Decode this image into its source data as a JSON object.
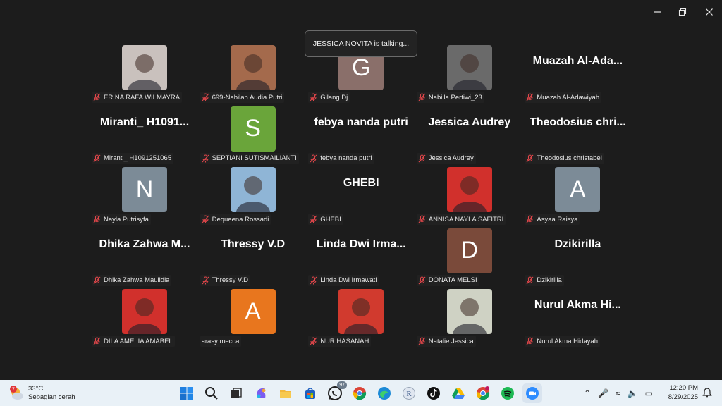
{
  "window": {
    "controls": {
      "minimize": "minimize-icon",
      "maximize": "restore-icon",
      "close": "close-icon"
    }
  },
  "banner": {
    "text": "JESSICA NOVITA is talking..."
  },
  "participants": [
    {
      "name": "ERINA RAFA WILMAYRA",
      "type": "photo",
      "color": "#c9c1bd"
    },
    {
      "name": "699-Nabilah Audia Putri",
      "type": "photo",
      "color": "#a46a4c"
    },
    {
      "name": "Gilang Dj",
      "type": "letter",
      "letter": "G",
      "color": "#8a6f6a"
    },
    {
      "name": "Nabilla Pertiwi_23",
      "type": "photo",
      "color": "#6a6a6a"
    },
    {
      "name": "Muazah Al-Adawiyah",
      "type": "text",
      "display": "Muazah  Al-Ada..."
    },
    {
      "name": "Miranti_ H1091251065",
      "type": "text",
      "display": "Miranti_  H1091..."
    },
    {
      "name": "SEPTIANI SUTISMAILIANTI",
      "type": "letter",
      "letter": "S",
      "color": "#6aa53a"
    },
    {
      "name": "febya nanda putri",
      "type": "text",
      "display": "febya nanda putri"
    },
    {
      "name": "Jessica Audrey",
      "type": "text",
      "display": "Jessica Audrey"
    },
    {
      "name": "Theodosius christabel",
      "type": "text",
      "display": "Theodosius  chri..."
    },
    {
      "name": "Nayla Putrisyfa",
      "type": "letter",
      "letter": "N",
      "color": "#7c8b97"
    },
    {
      "name": "Dequeena Rossadi",
      "type": "photo",
      "color": "#8fb5d6"
    },
    {
      "name": "GHEBI",
      "type": "text",
      "display": "GHEBI"
    },
    {
      "name": "ANNISA NAYLA SAFITRI",
      "type": "photo",
      "color": "#d1302c"
    },
    {
      "name": "Asyaa Raisya",
      "type": "letter",
      "letter": "A",
      "color": "#7c8b97"
    },
    {
      "name": "Dhika Zahwa Maulidia",
      "type": "text",
      "display": "Dhika  Zahwa  M..."
    },
    {
      "name": "Thressy V.D",
      "type": "text",
      "display": "Thressy V.D"
    },
    {
      "name": "Linda  Dwi Irmawati",
      "type": "text",
      "display": "Linda  Dwi  Irma..."
    },
    {
      "name": "DONATA MELSI",
      "type": "letter",
      "letter": "D",
      "color": "#7a4a3a"
    },
    {
      "name": "Dzikirilla",
      "type": "text",
      "display": "Dzikirilla"
    },
    {
      "name": "DILA AMELIA AMABEL",
      "type": "photo",
      "color": "#d1302c"
    },
    {
      "name": "arasy mecca",
      "type": "letter",
      "letter": "A",
      "color": "#e8761e",
      "nomic": true
    },
    {
      "name": "NUR HASANAH",
      "type": "photo",
      "color": "#d13a2e"
    },
    {
      "name": "Natalie Jessica",
      "type": "photo",
      "color": "#cfd2c4"
    },
    {
      "name": "Nurul Akma Hidayah",
      "type": "text",
      "display": "Nurul  Akma  Hi..."
    }
  ],
  "taskbar": {
    "weather": {
      "temp": "33°C",
      "desc": "Sebagian cerah",
      "badge": "7"
    },
    "apps": [
      "windows-start-icon",
      "search-icon",
      "task-view-icon",
      "copilot-icon",
      "file-explorer-icon",
      "store-icon",
      "whatsapp-icon",
      "chrome-icon",
      "edge-icon",
      "r-icon",
      "tiktok-icon",
      "google-drive-icon",
      "chrome-profile-icon",
      "spotify-icon",
      "zoom-icon"
    ],
    "whatsapp_badge": "97",
    "clock": {
      "time": "12:20 PM",
      "date": "8/29/2025"
    }
  }
}
